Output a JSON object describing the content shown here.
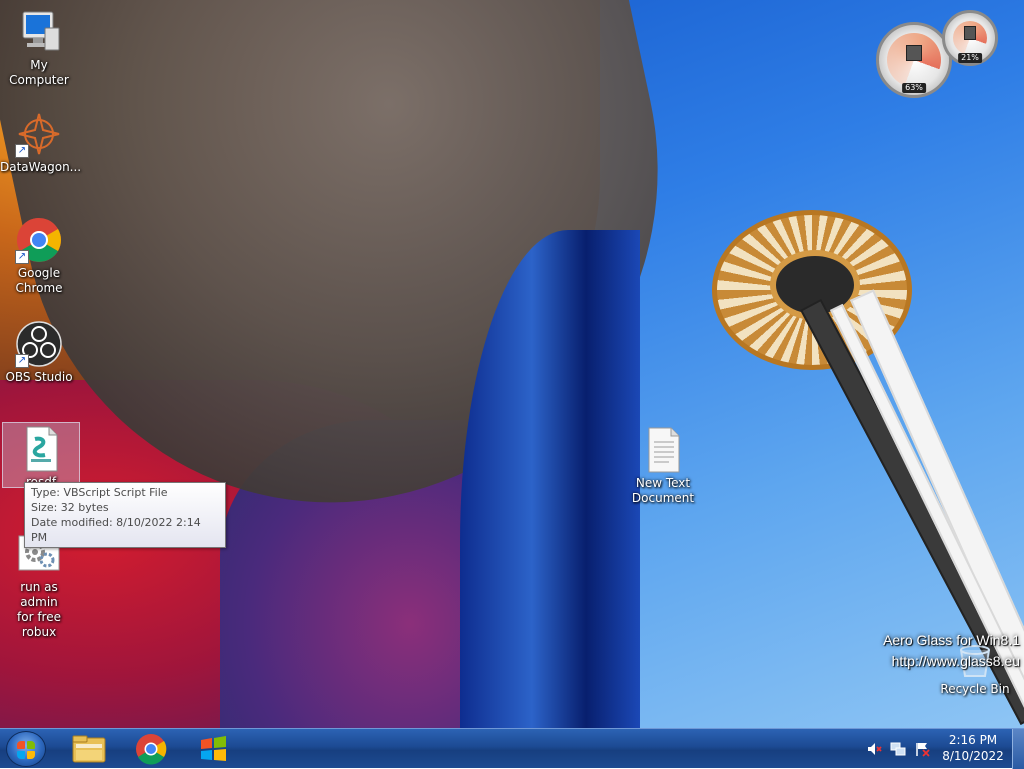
{
  "desktop_icons": [
    {
      "label": "My Computer"
    },
    {
      "label": "DataWagon..."
    },
    {
      "label_line1": "Google",
      "label_line2": "Chrome"
    },
    {
      "label": "OBS Studio"
    },
    {
      "label": "rosdf"
    },
    {
      "label_line1": "run as admin",
      "label_line2": "for free robux"
    },
    {
      "label_line1": "New Text",
      "label_line2": "Document"
    },
    {
      "label": "Recycle Bin"
    }
  ],
  "tooltip": {
    "type": "Type: VBScript Script File",
    "size": "Size: 32 bytes",
    "modified": "Date modified: 8/10/2022 2:14 PM"
  },
  "gadgets": {
    "cpu_percent": "63%",
    "memory_percent": "21%"
  },
  "watermark": {
    "line1": "Aero Glass for Win8.1",
    "line2": "http://www.glass8.eu"
  },
  "taskbar": {
    "pinned": [
      "windows-explorer",
      "google-chrome",
      "windows-media"
    ],
    "clock_time": "2:16 PM",
    "clock_date": "8/10/2022"
  },
  "colors": {
    "taskbar": "#1c4a93",
    "tooltip_border": "#767676"
  }
}
